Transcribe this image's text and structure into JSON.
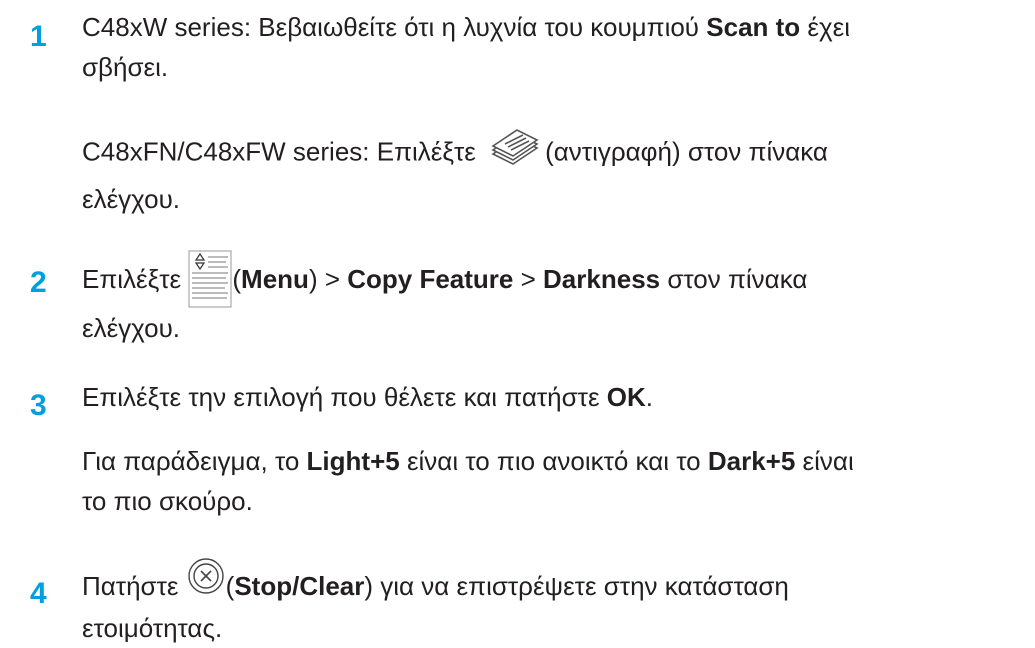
{
  "steps": [
    {
      "number": "1",
      "p1": {
        "line1_pre": "C48xW series: Βεβαιωθείτε ότι η λυχνία του κουμπιού ",
        "line1_bold": "Scan to",
        "line1_post": " έχει",
        "line2": "σβήσει."
      },
      "p2": {
        "pre": "C48xFN/C48xFW series: Επιλέξτε ",
        "icon": "copy-icon",
        "post": "(αντιγραφή) στον πίνακα",
        "line2": "ελέγχου."
      }
    },
    {
      "number": "2",
      "pre": "Επιλέξτε ",
      "icon": "menu-icon",
      "paren_open": "(",
      "menu": "Menu",
      "paren_close": ") > ",
      "copy_feature": "Copy Feature",
      "sep": " > ",
      "darkness": "Darkness",
      "post": " στον πίνακα",
      "line2": "ελέγχου."
    },
    {
      "number": "3",
      "p1": {
        "pre": "Επιλέξτε την επιλογή που θέλετε και πατήστε ",
        "bold": "OK",
        "post": "."
      },
      "p2": {
        "pre": "Για παράδειγμα, το ",
        "bold1": "Light+5",
        "mid": " είναι το πιο ανοικτό και το ",
        "bold2": "Dark+5",
        "post": " είναι",
        "line2": "το πιο σκούρο."
      }
    },
    {
      "number": "4",
      "pre": "Πατήστε ",
      "icon": "stop-clear-icon",
      "paren_open": "(",
      "bold": "Stop/Clear",
      "post": ") για να επιστρέψετε στην κατάσταση",
      "line2": "ετοιμότητας."
    }
  ]
}
